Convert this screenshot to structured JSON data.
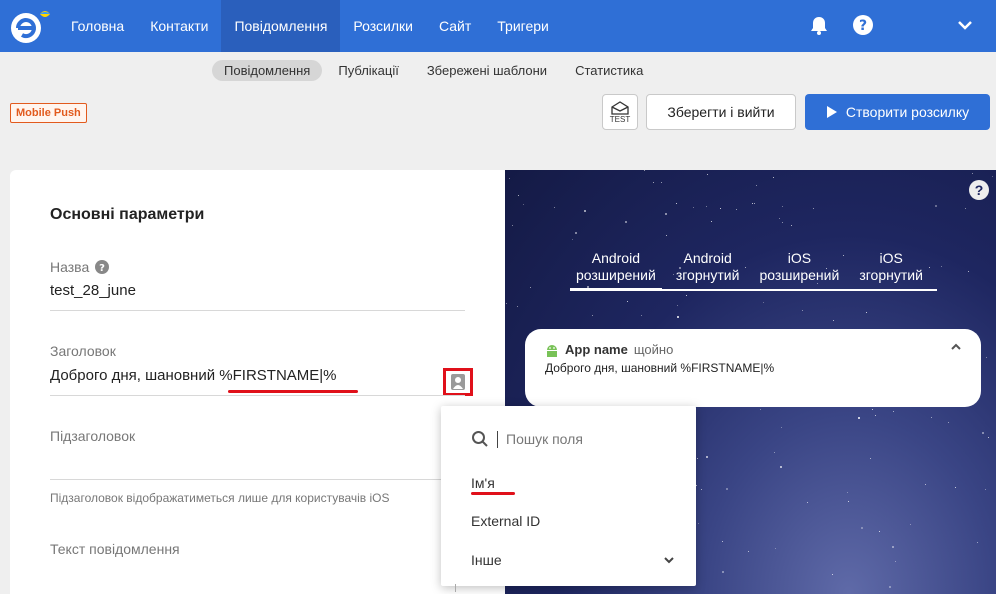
{
  "nav": {
    "items": [
      {
        "label": "Головна"
      },
      {
        "label": "Контакти"
      },
      {
        "label": "Повідомлення"
      },
      {
        "label": "Розсилки"
      },
      {
        "label": "Сайт"
      },
      {
        "label": "Тригери"
      }
    ],
    "active_index": 2,
    "icons": [
      "bell-icon",
      "help-icon",
      "chevron-down-icon"
    ]
  },
  "subnav": {
    "items": [
      {
        "label": "Повідомлення"
      },
      {
        "label": "Публікації"
      },
      {
        "label": "Збережені шаблони"
      },
      {
        "label": "Статистика"
      }
    ],
    "active_index": 0
  },
  "badge": "Mobile Push",
  "toolbar": {
    "test_label": "TEST",
    "save_label": "Зберегти і вийти",
    "create_label": "Створити розсилку"
  },
  "form": {
    "title": "Основні параметри",
    "name_label": "Назва",
    "name_value": "test_28_june",
    "header_label": "Заголовок",
    "header_value_prefix": "Доброго дня, шановний ",
    "header_value_var": "%FIRSTNAME|%",
    "subheader_label": "Підзаголовок",
    "subheader_hint": "Підзаголовок відображатиметься лише для користувачів iOS",
    "message_label": "Текст повідомлення"
  },
  "preview": {
    "tabs": [
      {
        "line1": "Android",
        "line2": "розширений"
      },
      {
        "line1": "Android",
        "line2": "згорнутий"
      },
      {
        "line1": "iOS",
        "line2": "розширений"
      },
      {
        "line1": "iOS",
        "line2": "згорнутий"
      }
    ],
    "active_tab": 0,
    "help_label": "?",
    "notification": {
      "app_name": "App name",
      "time": "щойно",
      "body": "Доброго дня, шановний %FIRSTNAME|%"
    }
  },
  "field_dropdown": {
    "search_placeholder": "Пошук поля",
    "items": [
      {
        "label": "Ім'я"
      },
      {
        "label": "External ID"
      },
      {
        "label": "Інше"
      }
    ]
  },
  "colors": {
    "brand": "#2f6fd6",
    "nav_active": "#2a5fbc",
    "badge": "#e25a1d",
    "highlight": "#e0101a"
  }
}
